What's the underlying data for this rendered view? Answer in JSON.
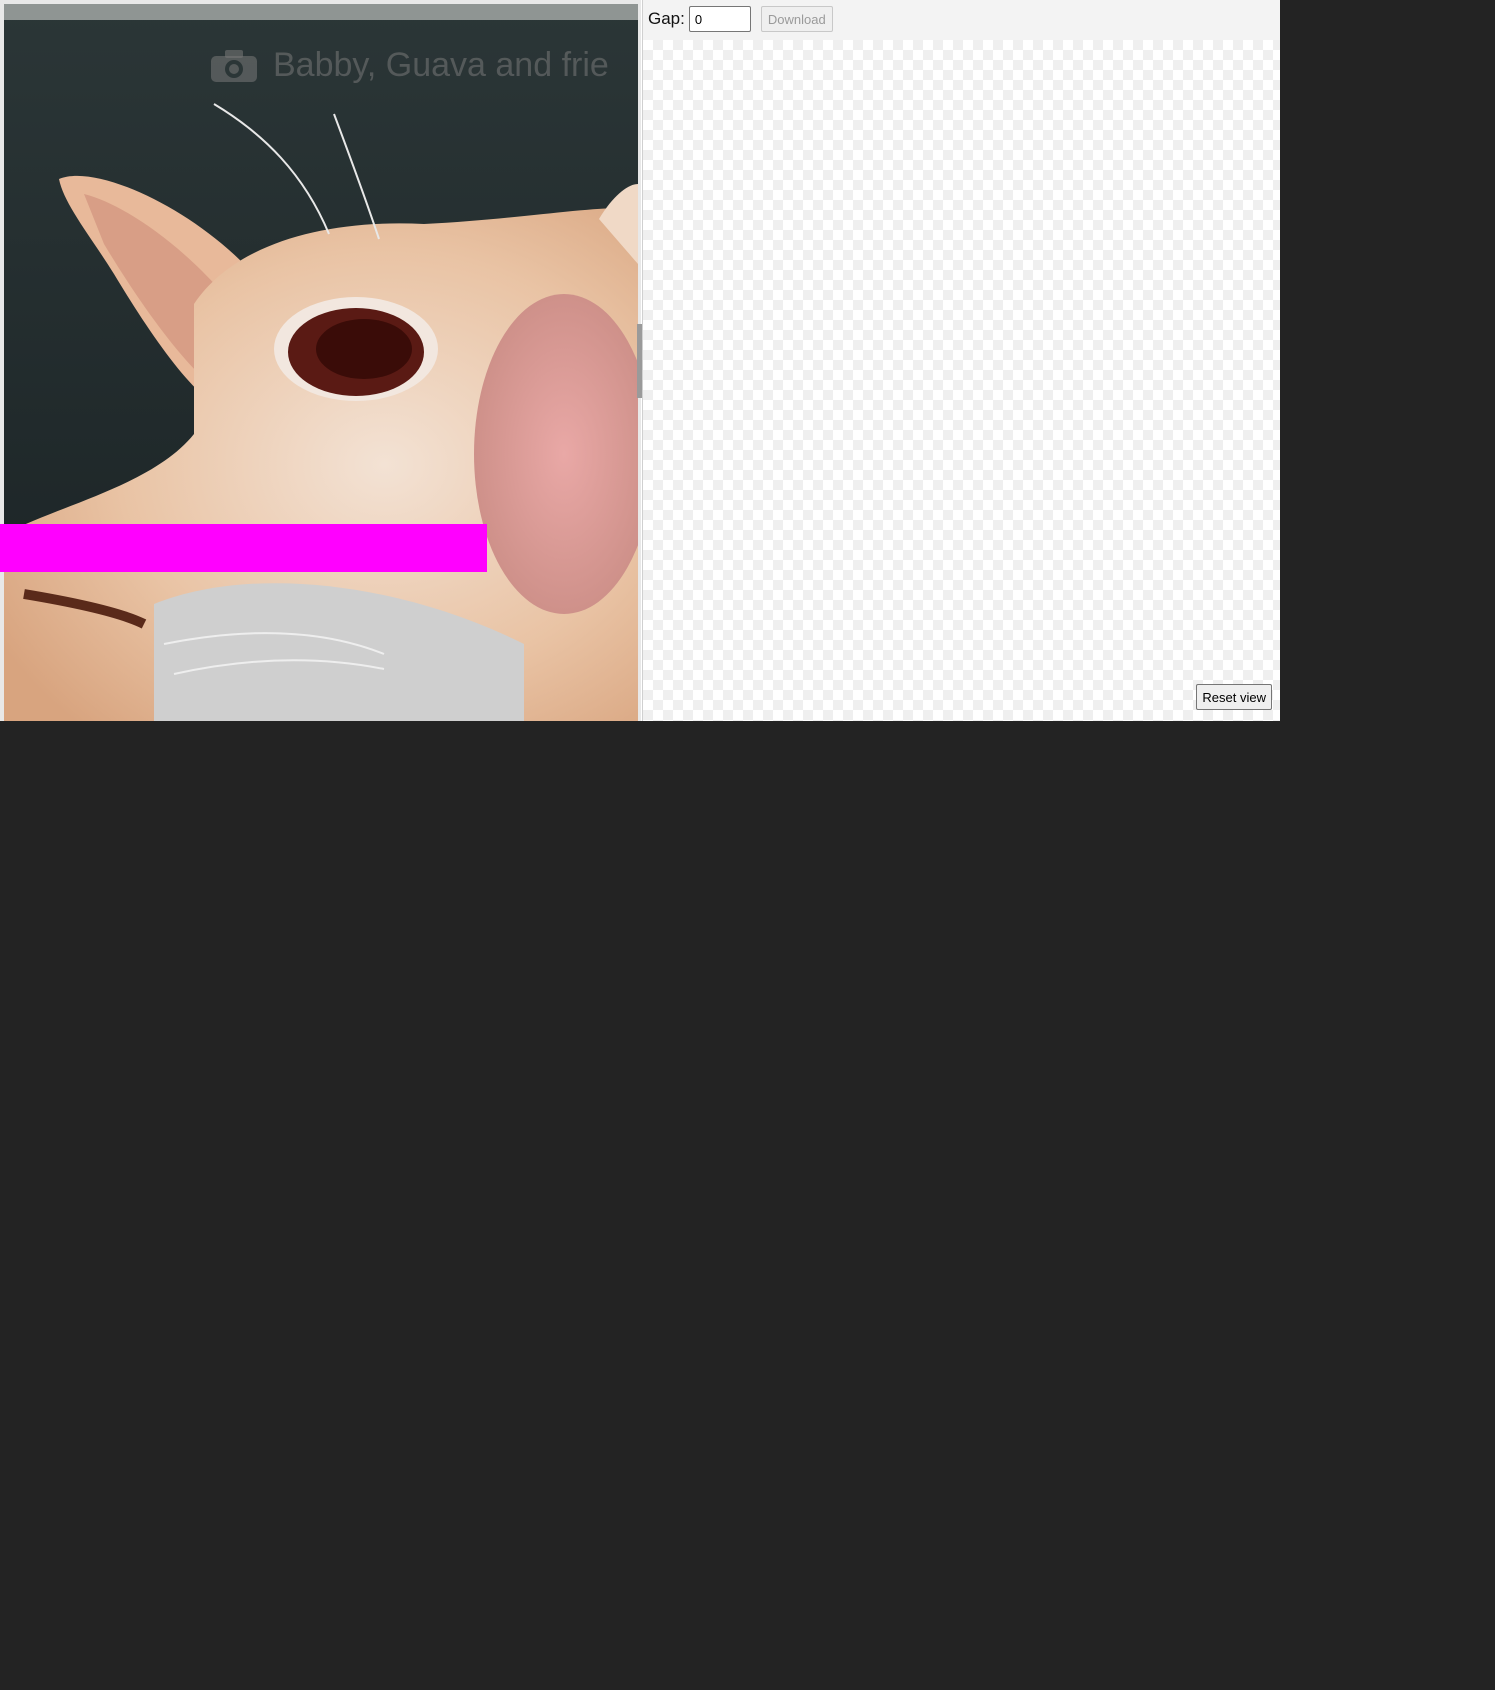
{
  "preview": {
    "watermark_text": "Babby, Guava and frie",
    "watermark_icon": "camera-icon",
    "highlight_color": "#ff00ff"
  },
  "toolbar": {
    "gap_label": "Gap:",
    "gap_value": "0",
    "download_label": "Download"
  },
  "canvas": {
    "reset_label": "Reset view"
  },
  "colors": {
    "background": "#232323",
    "panel": "#f3f3f3"
  }
}
